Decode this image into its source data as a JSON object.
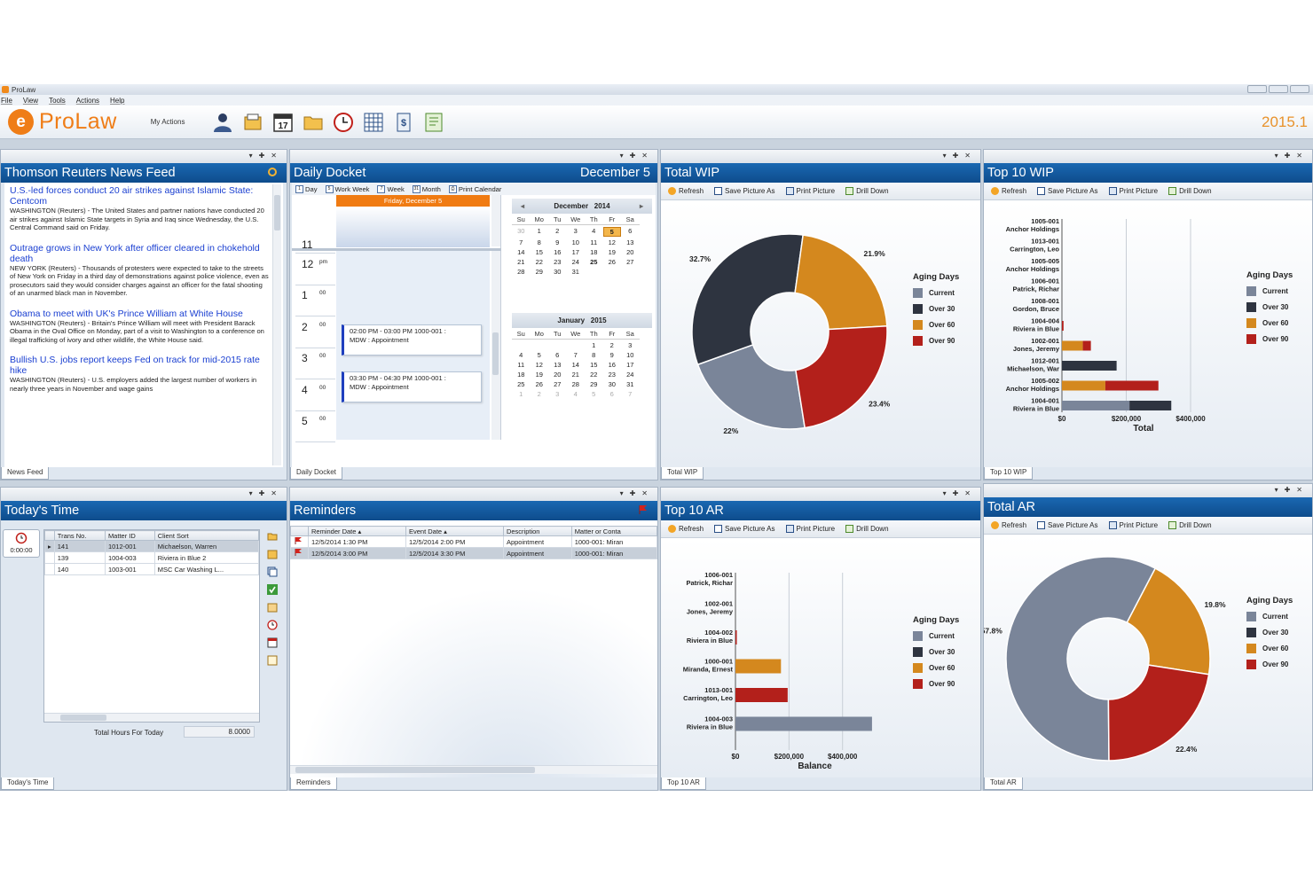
{
  "app": {
    "window_title": "ProLaw",
    "menu": [
      "File",
      "View",
      "Tools",
      "Actions",
      "Help"
    ],
    "brand": "ProLaw",
    "my_actions": "My Actions",
    "version": "2015.1",
    "toolbar_icons": [
      "contacts-icon",
      "matters-icon",
      "calendar-17-icon",
      "folder-icon",
      "clock-icon",
      "grid-icon",
      "billing-icon",
      "notes-icon"
    ]
  },
  "chart_toolbar": {
    "refresh": "Refresh",
    "save_picture": "Save Picture As",
    "print_picture": "Print Picture",
    "drill_down": "Drill Down"
  },
  "news": {
    "title": "Thomson Reuters News Feed",
    "tab": "News Feed",
    "items": [
      {
        "headline": "U.S.-led forces conduct 20 air strikes against Islamic State: Centcom",
        "body": "WASHINGTON (Reuters) - The United States and partner nations have conducted 20 air strikes against Islamic State targets in Syria and Iraq since Wednesday, the U.S. Central Command said on Friday."
      },
      {
        "headline": "Outrage grows in New York after officer cleared in chokehold death",
        "body": "NEW YORK (Reuters) - Thousands of protesters were expected to take to the streets of New York on Friday in a third day of demonstrations against police violence, even as prosecutors said they would consider charges against an officer for the fatal shooting of an unarmed black man in November."
      },
      {
        "headline": "Obama to meet with UK's Prince William at White House",
        "body": "WASHINGTON (Reuters) - Britain's Prince William will meet with President Barack Obama in the Oval Office on Monday, part of a visit to Washington to a conference on illegal trafficking of ivory and other wildlife, the White House said."
      },
      {
        "headline": "Bullish U.S. jobs report keeps Fed on track for mid-2015 rate hike",
        "body": "WASHINGTON (Reuters) - U.S. employers added the largest number of workers in nearly three years in November and wage gains"
      }
    ]
  },
  "docket": {
    "title": "Daily Docket",
    "date": "December 5",
    "tab": "Daily Docket",
    "views": [
      "Day",
      "Work Week",
      "Week",
      "Month",
      "Print Calendar"
    ],
    "day_header": "Friday, December 5",
    "time_slots": [
      {
        "hour": "11",
        "min": ""
      },
      {
        "hour": "12",
        "min": "pm"
      },
      {
        "hour": "1",
        "min": "00"
      },
      {
        "hour": "2",
        "min": "00"
      },
      {
        "hour": "3",
        "min": "00"
      },
      {
        "hour": "4",
        "min": "00"
      },
      {
        "hour": "5",
        "min": "00"
      }
    ],
    "appointments": [
      {
        "line1": "02:00 PM - 03:00 PM 1000-001 :",
        "line2": "MDW : Appointment"
      },
      {
        "line1": "03:30 PM - 04:30 PM 1000-001 :",
        "line2": "MDW : Appointment"
      }
    ],
    "calendars": [
      {
        "month": "December",
        "year": "2014",
        "dow": [
          "Su",
          "Mo",
          "Tu",
          "We",
          "Th",
          "Fr",
          "Sa"
        ],
        "weeks": [
          [
            "30",
            "1",
            "2",
            "3",
            "4",
            "5",
            "6"
          ],
          [
            "7",
            "8",
            "9",
            "10",
            "11",
            "12",
            "13"
          ],
          [
            "14",
            "15",
            "16",
            "17",
            "18",
            "19",
            "20"
          ],
          [
            "21",
            "22",
            "23",
            "24",
            "25",
            "26",
            "27"
          ],
          [
            "28",
            "29",
            "30",
            "31",
            "",
            "",
            ""
          ]
        ],
        "today": "5"
      },
      {
        "month": "January",
        "year": "2015",
        "dow": [
          "Su",
          "Mo",
          "Tu",
          "We",
          "Th",
          "Fr",
          "Sa"
        ],
        "weeks": [
          [
            "",
            "",
            "",
            "",
            "1",
            "2",
            "3"
          ],
          [
            "4",
            "5",
            "6",
            "7",
            "8",
            "9",
            "10"
          ],
          [
            "11",
            "12",
            "13",
            "14",
            "15",
            "16",
            "17"
          ],
          [
            "18",
            "19",
            "20",
            "21",
            "22",
            "23",
            "24"
          ],
          [
            "25",
            "26",
            "27",
            "28",
            "29",
            "30",
            "31"
          ],
          [
            "1",
            "2",
            "3",
            "4",
            "5",
            "6",
            "7"
          ]
        ],
        "today": ""
      }
    ]
  },
  "total_wip": {
    "title": "Total WIP",
    "tab": "Total WIP",
    "legend_title": "Aging Days",
    "legend": [
      "Current",
      "Over 30",
      "Over 60",
      "Over 90"
    ]
  },
  "top10_wip": {
    "title": "Top 10 WIP",
    "tab": "Top 10 WIP",
    "legend_title": "Aging Days",
    "legend": [
      "Current",
      "Over 30",
      "Over 60",
      "Over 90"
    ]
  },
  "todays_time": {
    "title": "Today's Time",
    "tab": "Today's Time",
    "timer": "0:00:00",
    "columns": [
      "Trans No.",
      "Matter ID",
      "Client Sort"
    ],
    "rows": [
      [
        "141",
        "1012-001",
        "Michaelson, Warren"
      ],
      [
        "139",
        "1004-003",
        "Riviera in Blue 2"
      ],
      [
        "140",
        "1003-001",
        "MSC Car Washing L..."
      ]
    ],
    "total_label": "Total Hours For Today",
    "total_value": "8.0000"
  },
  "reminders": {
    "title": "Reminders",
    "tab": "Reminders",
    "columns": [
      "Reminder Date",
      "Event Date",
      "Description",
      "Matter or Conta"
    ],
    "rows": [
      [
        "12/5/2014 1:30 PM",
        "12/5/2014 2:00 PM",
        "Appointment",
        "1000-001: Miran"
      ],
      [
        "12/5/2014 3:00 PM",
        "12/5/2014 3:30 PM",
        "Appointment",
        "1000-001: Miran"
      ]
    ]
  },
  "top10_ar": {
    "title": "Top 10 AR",
    "tab": "Top 10 AR",
    "legend_title": "Aging Days",
    "legend": [
      "Current",
      "Over 30",
      "Over 60",
      "Over 90"
    ]
  },
  "total_ar": {
    "title": "Total AR",
    "tab": "Total AR",
    "legend_title": "Aging Days",
    "legend": [
      "Current",
      "Over 30",
      "Over 60",
      "Over 90"
    ]
  },
  "colors": {
    "current": "#7a8599",
    "over30": "#2e3440",
    "over60": "#d4881e",
    "over90": "#b3201b"
  },
  "chart_data": [
    {
      "type": "pie",
      "title": "Total WIP",
      "categories": [
        "Current",
        "Over 30",
        "Over 60",
        "Over 90"
      ],
      "values": [
        22,
        32.7,
        21.9,
        23.4
      ],
      "labels": [
        "22%",
        "32.7%",
        "21.9%",
        "23.4%"
      ]
    },
    {
      "type": "bar",
      "title": "Top 10 WIP",
      "xlabel": "Total",
      "stacked": true,
      "categories": [
        [
          "1005-001",
          "Anchor Holdings"
        ],
        [
          "1013-001",
          "Carrington, Leo"
        ],
        [
          "1005-005",
          "Anchor Holdings"
        ],
        [
          "1006-001",
          "Patrick, Richar"
        ],
        [
          "1008-001",
          "Gordon, Bruce"
        ],
        [
          "1004-004",
          "Riviera in Blue"
        ],
        [
          "1002-001",
          "Jones, Jeremy"
        ],
        [
          "1012-001",
          "Michaelson, War"
        ],
        [
          "1005-002",
          "Anchor Holdings"
        ],
        [
          "1004-001",
          "Riviera in Blue"
        ]
      ],
      "series": [
        {
          "name": "Current",
          "values": [
            0,
            0,
            0,
            0,
            0,
            0,
            0,
            0,
            0,
            210000
          ]
        },
        {
          "name": "Over 30",
          "values": [
            0,
            0,
            0,
            0,
            0,
            0,
            0,
            170000,
            0,
            130000
          ]
        },
        {
          "name": "Over 60",
          "values": [
            0,
            0,
            0,
            0,
            0,
            0,
            65000,
            0,
            135000,
            0
          ]
        },
        {
          "name": "Over 90",
          "values": [
            0,
            0,
            0,
            0,
            0,
            5000,
            25000,
            0,
            165000,
            0
          ]
        }
      ],
      "xlim": [
        0,
        480000
      ],
      "xticks": [
        "$0",
        "$200,000",
        "$400,000"
      ]
    },
    {
      "type": "bar",
      "title": "Top 10 AR",
      "xlabel": "Balance",
      "stacked": true,
      "categories": [
        [
          "1006-001",
          "Patrick, Richar"
        ],
        [
          "1002-001",
          "Jones, Jeremy"
        ],
        [
          "1004-002",
          "Riviera in Blue"
        ],
        [
          "1000-001",
          "Miranda, Ernest"
        ],
        [
          "1013-001",
          "Carrington, Leo"
        ],
        [
          "1004-003",
          "Riviera in Blue"
        ]
      ],
      "series": [
        {
          "name": "Current",
          "values": [
            0,
            0,
            0,
            0,
            0,
            510000
          ]
        },
        {
          "name": "Over 30",
          "values": [
            0,
            0,
            0,
            0,
            0,
            0
          ]
        },
        {
          "name": "Over 60",
          "values": [
            0,
            0,
            0,
            170000,
            0,
            0
          ]
        },
        {
          "name": "Over 90",
          "values": [
            0,
            0,
            5000,
            0,
            195000,
            0
          ]
        }
      ],
      "xlim": [
        0,
        560000
      ],
      "xticks": [
        "$0",
        "$200,000",
        "$400,000"
      ]
    },
    {
      "type": "pie",
      "title": "Total AR",
      "categories": [
        "Current",
        "Over 30",
        "Over 60",
        "Over 90"
      ],
      "values": [
        57.8,
        0,
        19.8,
        22.4
      ],
      "labels": [
        "57.8%",
        "",
        "19.8%",
        "22.4%"
      ]
    }
  ]
}
